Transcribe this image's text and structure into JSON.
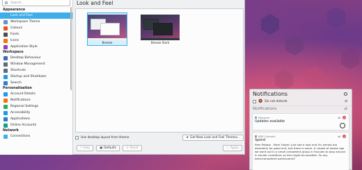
{
  "sidebar": {
    "search_placeholder": "Search...",
    "categories": [
      {
        "label": "Appearance",
        "items": [
          {
            "label": "Look and Feel",
            "icon": "look-and-feel-icon",
            "color": "#3daee9",
            "active": true
          },
          {
            "label": "Workspace Theme",
            "icon": "workspace-theme-icon",
            "color": "#6c8fc7"
          },
          {
            "label": "Colours",
            "icon": "colours-icon",
            "color": "#e95420"
          },
          {
            "label": "Fonts",
            "icon": "fonts-icon",
            "color": "#4d4d4d"
          },
          {
            "label": "Icons",
            "icon": "icons-icon",
            "color": "#f67400"
          },
          {
            "label": "Application Style",
            "icon": "application-style-icon",
            "color": "#8e44ad"
          }
        ]
      },
      {
        "label": "Workspace",
        "items": [
          {
            "label": "Desktop Behaviour",
            "icon": "desktop-behaviour-icon",
            "color": "#3d6bb5"
          },
          {
            "label": "Window Management",
            "icon": "window-management-icon",
            "color": "#5b6c7a"
          },
          {
            "label": "Shortcuts",
            "icon": "shortcuts-icon",
            "color": "#5b6c7a"
          },
          {
            "label": "Startup and Shutdown",
            "icon": "startup-shutdown-icon",
            "color": "#1d99f3"
          },
          {
            "label": "Search",
            "icon": "search-icon",
            "color": "#2a7fd4"
          }
        ]
      },
      {
        "label": "Personalisation",
        "items": [
          {
            "label": "Account Details",
            "icon": "account-details-icon",
            "color": "#1d99f3"
          },
          {
            "label": "Notifications",
            "icon": "notifications-icon",
            "color": "#f67400"
          },
          {
            "label": "Regional Settings",
            "icon": "regional-settings-icon",
            "color": "#27ae60"
          },
          {
            "label": "Accessibility",
            "icon": "accessibility-icon",
            "color": "#1d99f3"
          },
          {
            "label": "Applications",
            "icon": "applications-icon",
            "color": "#2980b9"
          },
          {
            "label": "Online Accounts",
            "icon": "online-accounts-icon",
            "color": "#16a085"
          }
        ]
      },
      {
        "label": "Network",
        "items": [
          {
            "label": "Connections",
            "icon": "connections-icon",
            "color": "#3daee9"
          }
        ]
      }
    ]
  },
  "main": {
    "title": "Look and Feel",
    "themes": [
      {
        "label": "Breeze",
        "selected": true
      },
      {
        "label": "Breeze Dark",
        "selected": false
      }
    ],
    "use_layout_label": "Use desktop layout from theme",
    "get_new_label": "Get New Look and Feel Themes...",
    "help_label": "Help",
    "defaults_label": "Defaults",
    "reset_label": "Reset",
    "apply_label": "Apply"
  },
  "notifications": {
    "title": "Notifications",
    "dnd_label": "Do not disturb",
    "section_title": "Notifications",
    "cards": [
      {
        "app": "Discover",
        "title": "Updates available",
        "body": ""
      },
      {
        "app": "KDE Connect",
        "title": "Spond",
        "body": "Peer Pobble - Mark Foster: Just had a look and it's almost too disorderly for good surf, but there is some. A couple of weeks ago we went out in a small competent group in Fuscoes to play around in similar conditions so this might be possible. So any keen/competent participants?"
      }
    ]
  }
}
